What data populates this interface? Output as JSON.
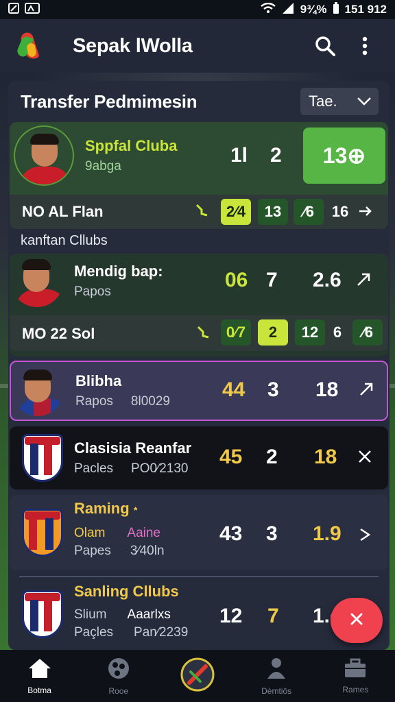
{
  "status_bar": {
    "battery": "9¾%",
    "time": "151 912"
  },
  "app_bar": {
    "title": "Sepak lWolla",
    "search_icon": "search-icon",
    "menu_icon": "more-vert-icon"
  },
  "panel": {
    "title": "Transfer Pedmimesin",
    "filter": {
      "value": "Tae."
    }
  },
  "featured": {
    "name": "Sppfal Cluba",
    "sub": "9abga",
    "stat1": "1l",
    "stat2": "2",
    "action_label": "13⊕",
    "detail": {
      "label": "NO AL Flan",
      "chips": [
        "2⁄4",
        "13",
        "⁄6",
        "16"
      ]
    }
  },
  "section_label": "kanftan Cllubs",
  "rows": [
    {
      "name": "Mendig bap:",
      "sub": "Papos",
      "sub2": "",
      "a": "06",
      "b": "7",
      "c": "2.6",
      "detail": {
        "label": "MO 22 Sol",
        "chips": [
          "0⁄7",
          "2",
          "12",
          "6",
          "⁄6"
        ]
      }
    },
    {
      "name": "Blibha",
      "sub": "Rapos",
      "sub2": "8l0029",
      "a": "44",
      "b": "3",
      "c": "18"
    },
    {
      "name": "Clasisia Reanfar",
      "sub": "Pacles",
      "sub2": "PO0⁄2130",
      "a": "45",
      "b": "2",
      "c": "18"
    },
    {
      "name": "Raming",
      "name_tail": "*",
      "sub": "Olam",
      "sub_b": "Aaine",
      "sub3": "Papes",
      "sub2": "3⁄40ln",
      "a": "43",
      "b": "3",
      "c": "1.9"
    },
    {
      "name": "Sanling Cllubs",
      "sub": "Slium",
      "sub_b": "Aaarlxs",
      "sub3": "Paçles",
      "sub2": "Pan⁄2239",
      "a": "12",
      "b": "7",
      "c": "1.o"
    }
  ],
  "fab": {
    "icon": "close-icon"
  },
  "bottom_nav": [
    {
      "label": "Botma",
      "icon": "home-icon"
    },
    {
      "label": "Rooe",
      "icon": "ball-icon"
    },
    {
      "label": "",
      "icon": "center-logo-icon"
    },
    {
      "label": "Dèmtiōs",
      "icon": "person-icon"
    },
    {
      "label": "Rames",
      "icon": "briefcase-icon"
    }
  ]
}
